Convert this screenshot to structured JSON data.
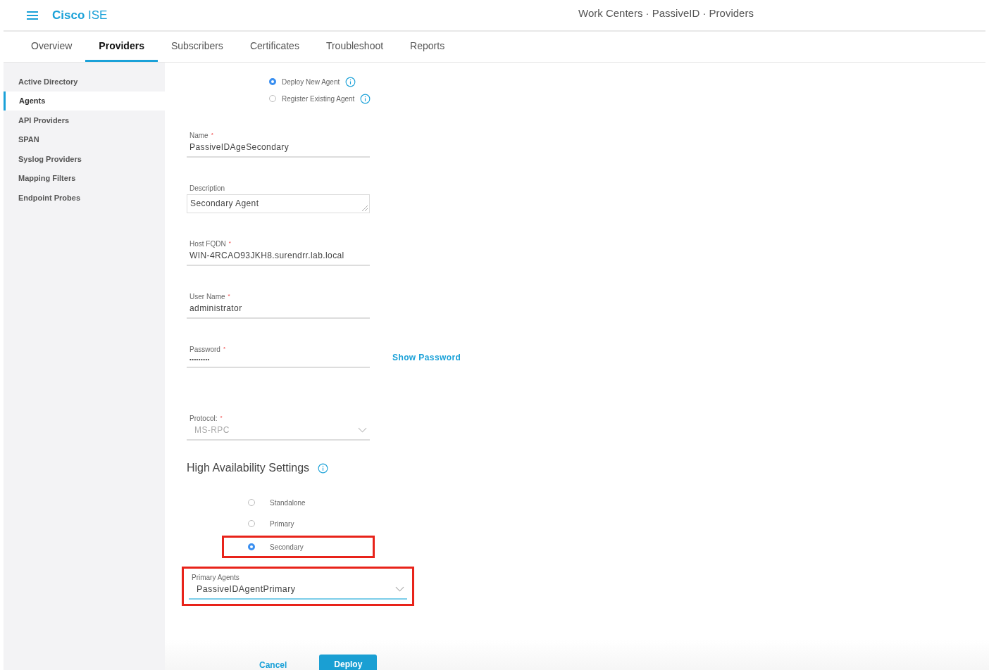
{
  "header": {
    "brand_bold": "Cisco",
    "brand_light": "ISE",
    "breadcrumb": "Work Centers · PassiveID · Providers"
  },
  "tabs": [
    {
      "label": "Overview",
      "selected": false
    },
    {
      "label": "Providers",
      "selected": true
    },
    {
      "label": "Subscribers",
      "selected": false
    },
    {
      "label": "Certificates",
      "selected": false
    },
    {
      "label": "Troubleshoot",
      "selected": false
    },
    {
      "label": "Reports",
      "selected": false
    }
  ],
  "sidebar": {
    "items": [
      {
        "label": "Active Directory",
        "selected": false
      },
      {
        "label": "Agents",
        "selected": true
      },
      {
        "label": "API Providers",
        "selected": false
      },
      {
        "label": "SPAN",
        "selected": false
      },
      {
        "label": "Syslog Providers",
        "selected": false
      },
      {
        "label": "Mapping Filters",
        "selected": false
      },
      {
        "label": "Endpoint Probes",
        "selected": false
      }
    ]
  },
  "agent_mode": [
    {
      "label": "Deploy New Agent",
      "selected": true
    },
    {
      "label": "Register Existing Agent",
      "selected": false
    }
  ],
  "fields": [
    {
      "kind": "text",
      "label": "Name",
      "required_mark": "*",
      "value": "PassiveIDAgeSecondary"
    },
    {
      "kind": "textarea",
      "label": "Description",
      "value": "Secondary Agent"
    },
    {
      "kind": "text",
      "label": "Host FQDN",
      "required_mark": "*",
      "value": "WIN-4RCAO93JKH8.surendrr.lab.local"
    },
    {
      "kind": "text",
      "label": "User Name",
      "required_mark": "*",
      "value": "administrator"
    },
    {
      "kind": "password",
      "label": "Password",
      "required_mark": "*",
      "value": "•••••••••",
      "link": "Show Password"
    },
    {
      "kind": "select",
      "label": "Protocol:",
      "required_mark": "*",
      "value": "MS-RPC",
      "disabled": true
    }
  ],
  "ha": {
    "title": "High Availability Settings",
    "options": [
      {
        "label": "Standalone",
        "selected": false,
        "highlighted": false
      },
      {
        "label": "Primary",
        "selected": false,
        "highlighted": false
      },
      {
        "label": "Secondary",
        "selected": true,
        "highlighted": true
      }
    ],
    "primary_agents": {
      "label": "Primary Agents",
      "value": "PassiveIDAgentPrimary",
      "highlighted": true
    }
  },
  "buttons": {
    "cancel": "Cancel",
    "deploy": "Deploy"
  }
}
